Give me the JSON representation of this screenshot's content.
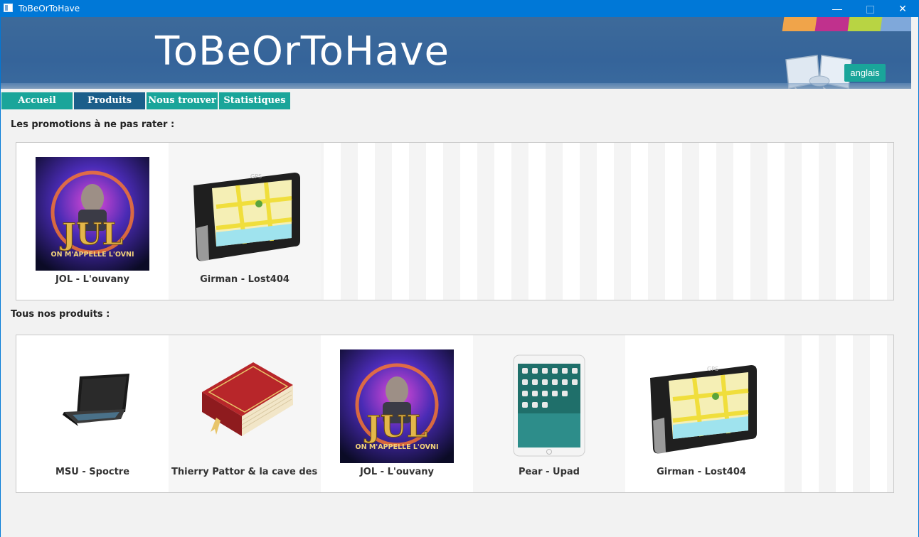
{
  "window": {
    "title": "ToBeOrToHave",
    "minimize": "—",
    "close": "✕"
  },
  "banner": {
    "title": "ToBeOrToHave",
    "lang_button": "anglais"
  },
  "tabs": [
    {
      "label": "Accueil"
    },
    {
      "label": "Produits"
    },
    {
      "label": "Nous trouver"
    },
    {
      "label": "Statistiques"
    }
  ],
  "promotions": {
    "heading": "Les promotions à ne pas rater :",
    "items": [
      {
        "label": "JOL - L'ouvany",
        "icon": "album-cover-icon"
      },
      {
        "label": "Girman - Lost404",
        "icon": "gps-device-icon"
      }
    ]
  },
  "products": {
    "heading": "Tous nos produits :",
    "items": [
      {
        "label": "MSU - Spoctre",
        "icon": "laptop-icon"
      },
      {
        "label": "Thierry Pattor & la cave des ...",
        "icon": "book-icon"
      },
      {
        "label": "JOL - L'ouvany",
        "icon": "album-cover-icon"
      },
      {
        "label": "Pear - Upad",
        "icon": "tablet-icon"
      },
      {
        "label": "Girman - Lost404",
        "icon": "gps-device-icon"
      }
    ]
  },
  "album_art_text": {
    "logo": "JUL",
    "subtitle": "ON M'APPELLE L'OVNI"
  },
  "gps_text": {
    "brand": "GPS"
  },
  "colors": {
    "titlebar": "#0078d7",
    "banner": "#35649a",
    "tab_active": "#1b5e8a",
    "tab": "#1aa59a"
  }
}
